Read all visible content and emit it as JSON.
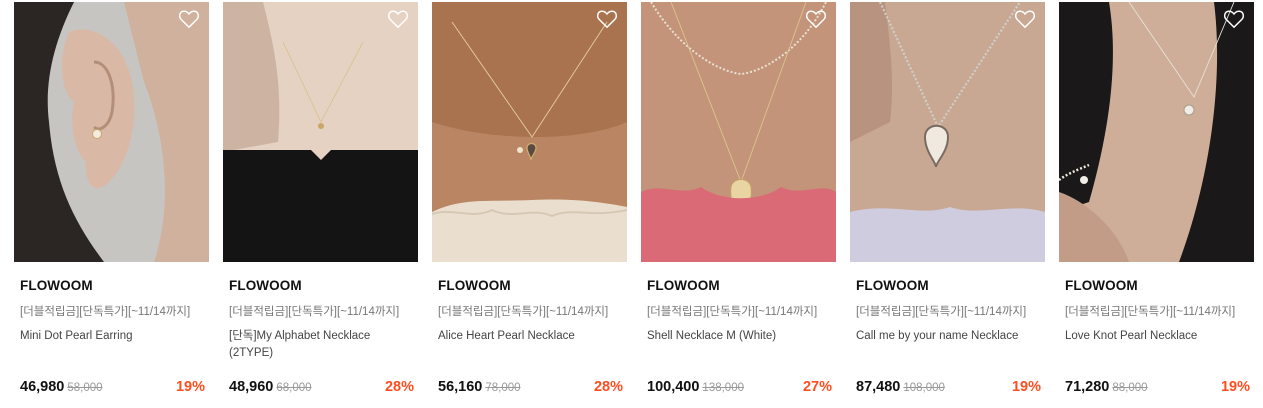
{
  "products": [
    {
      "brand": "FLOWOOM",
      "promo": "[더블적립금][단독특가][~11/14까지]",
      "name": "Mini Dot Pearl Earring",
      "price": "46,980",
      "original_price": "58,000",
      "discount": "19%",
      "image_icon": "earring-photo"
    },
    {
      "brand": "FLOWOOM",
      "promo": "[더블적립금][단독특가][~11/14까지]",
      "name": "[단독]My Alphabet Necklace (2TYPE)",
      "price": "48,960",
      "original_price": "68,000",
      "discount": "28%",
      "image_icon": "necklace-photo"
    },
    {
      "brand": "FLOWOOM",
      "promo": "[더블적립금][단독특가][~11/14까지]",
      "name": "Alice Heart Pearl Necklace",
      "price": "56,160",
      "original_price": "78,000",
      "discount": "28%",
      "image_icon": "necklace-photo"
    },
    {
      "brand": "FLOWOOM",
      "promo": "[더블적립금][단독특가][~11/14까지]",
      "name": "Shell Necklace M (White)",
      "price": "100,400",
      "original_price": "138,000",
      "discount": "27%",
      "image_icon": "necklace-photo"
    },
    {
      "brand": "FLOWOOM",
      "promo": "[더블적립금][단독특가][~11/14까지]",
      "name": "Call me by your name Necklace",
      "price": "87,480",
      "original_price": "108,000",
      "discount": "19%",
      "image_icon": "necklace-photo"
    },
    {
      "brand": "FLOWOOM",
      "promo": "[더블적립금][단독특가][~11/14까지]",
      "name": "Love Knot Pearl Necklace",
      "price": "71,280",
      "original_price": "88,000",
      "discount": "19%",
      "image_icon": "necklace-photo"
    }
  ],
  "colors": {
    "discount": "#ff4d1f",
    "brand_text": "#111111",
    "promo_text": "#777777",
    "original_price_text": "#999999"
  },
  "icons": {
    "wishlist": "heart-outline-icon"
  }
}
